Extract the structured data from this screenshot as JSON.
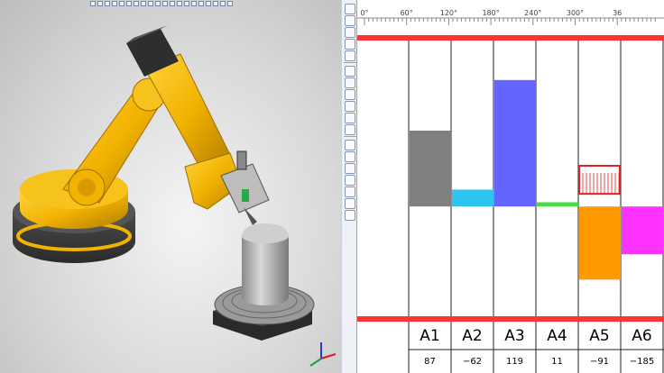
{
  "scale": {
    "ticks": [
      "0°",
      "60°",
      "120°",
      "180°",
      "240°",
      "300°",
      "36"
    ]
  },
  "joints": [
    {
      "name": "A1",
      "value": "87",
      "color": "#7f7f7f",
      "top": 0.33,
      "bottom": 0.6
    },
    {
      "name": "A2",
      "value": "−62",
      "color": "#2ec4f0",
      "top": 0.54,
      "bottom": 0.6
    },
    {
      "name": "A3",
      "value": "119",
      "color": "#6464ff",
      "top": 0.15,
      "bottom": 0.6
    },
    {
      "name": "A4",
      "value": "11",
      "color": "#44dd44",
      "top": 0.585,
      "bottom": 0.6
    },
    {
      "name": "A5",
      "value": "−91",
      "color": "#ff9900",
      "top": 0.6,
      "bottom": 0.86
    },
    {
      "name": "A6",
      "value": "−185",
      "color": "#ff33ff",
      "top": 0.6,
      "bottom": 0.77
    }
  ],
  "colors": {
    "limit_line": "#ff3333",
    "highlight": "#e02020",
    "robot": "#f2b300",
    "base_dark": "#3c3c3c"
  },
  "icons": {
    "axis_triad": "xyz-axis-icon"
  }
}
